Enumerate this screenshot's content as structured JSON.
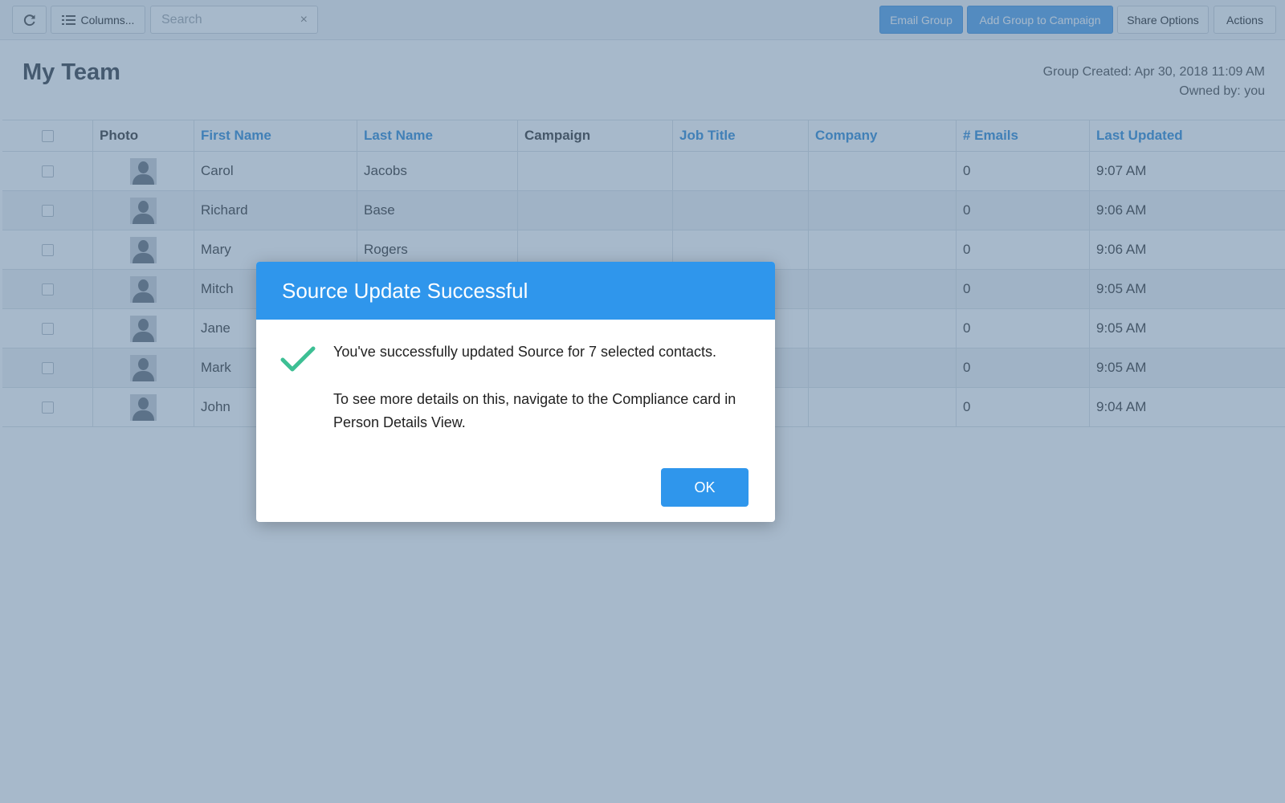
{
  "toolbar": {
    "refresh_icon": "refresh-icon",
    "columns_label": "Columns...",
    "columns_icon": "list-icon",
    "search_placeholder": "Search",
    "search_clear": "×",
    "email_group_label": "Email Group",
    "add_campaign_label": "Add Group to Campaign",
    "share_label": "Share Options",
    "actions_label": "Actions",
    "accent_color": "#5fa7ea"
  },
  "page": {
    "title": "My Team",
    "created": "Group Created: Apr 30, 2018 11:09 AM",
    "owned": "Owned by: you"
  },
  "table": {
    "headers": {
      "photo": "Photo",
      "first_name": "First Name",
      "last_name": "Last Name",
      "campaign": "Campaign",
      "job_title": "Job Title",
      "company": "Company",
      "emails": "# Emails",
      "last_updated": "Last Updated"
    },
    "rows": [
      {
        "first": "Carol",
        "last": "Jacobs",
        "campaign": "",
        "job": "",
        "company": "",
        "emails": "0",
        "updated": "9:07 AM"
      },
      {
        "first": "Richard",
        "last": "Base",
        "campaign": "",
        "job": "",
        "company": "",
        "emails": "0",
        "updated": "9:06 AM"
      },
      {
        "first": "Mary",
        "last": "Rogers",
        "campaign": "",
        "job": "",
        "company": "",
        "emails": "0",
        "updated": "9:06 AM"
      },
      {
        "first": "Mitch",
        "last": "",
        "campaign": "",
        "job": "",
        "company": "",
        "emails": "0",
        "updated": "9:05 AM"
      },
      {
        "first": "Jane",
        "last": "",
        "campaign": "",
        "job": "",
        "company": "",
        "emails": "0",
        "updated": "9:05 AM"
      },
      {
        "first": "Mark",
        "last": "",
        "campaign": "",
        "job": "",
        "company": "",
        "emails": "0",
        "updated": "9:05 AM"
      },
      {
        "first": "John",
        "last": "",
        "campaign": "",
        "job": "",
        "company": "",
        "emails": "0",
        "updated": "9:04 AM"
      }
    ]
  },
  "modal": {
    "title": "Source Update Successful",
    "icon": "checkmark-icon",
    "message1": "You've successfully updated Source for 7 selected contacts.",
    "message2": "To see more details on this, navigate to the Compliance card in Person Details View.",
    "ok_label": "OK",
    "header_color": "#2f96ec",
    "check_color": "#3dbf94"
  }
}
